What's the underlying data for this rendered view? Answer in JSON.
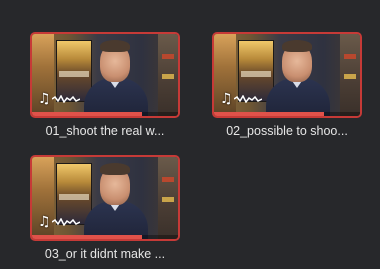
{
  "media_pool": {
    "clips": [
      {
        "name": "01_shoot the real w...",
        "has_audio": true,
        "audio_icon": "music-note-icon",
        "progress": 0.75
      },
      {
        "name": "02_possible to shoo...",
        "has_audio": true,
        "audio_icon": "music-note-icon",
        "progress": 0.75
      },
      {
        "name": "03_or it didnt make ...",
        "has_audio": true,
        "audio_icon": "music-note-icon",
        "progress": 0.75
      }
    ],
    "selection_color": "#c63a37",
    "progress_color": "#e0524a"
  }
}
